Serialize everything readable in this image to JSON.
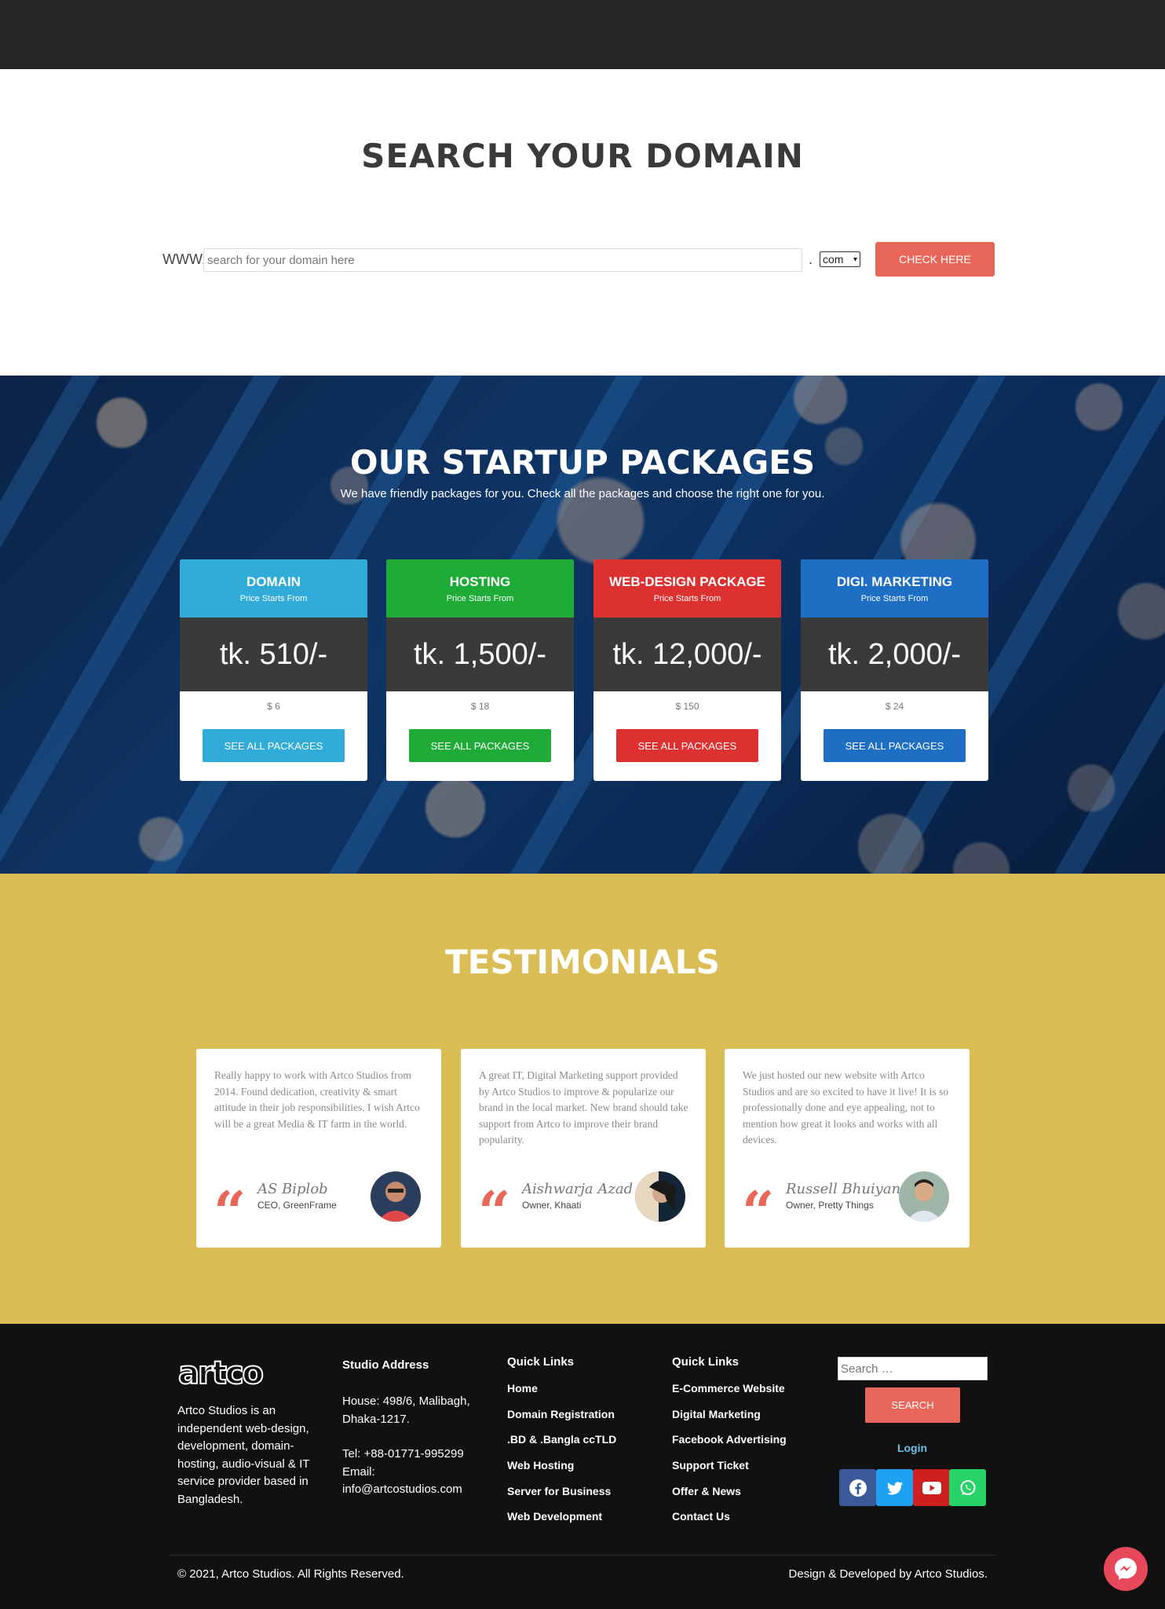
{
  "domain_search": {
    "title": "SEARCH YOUR DOMAIN",
    "prefix": "WWW.",
    "placeholder": "search for your domain here",
    "dot": ".",
    "tld_selected": "com",
    "button": "CHECK HERE"
  },
  "packages": {
    "title": "OUR STARTUP PACKAGES",
    "subtitle": "We have friendly packages for you. Check all the packages and choose the right one for you.",
    "items": [
      {
        "name": "DOMAIN",
        "caption": "Price Starts From",
        "price": "tk. 510/-",
        "usd": "$ 6",
        "button": "SEE ALL PACKAGES",
        "color": "#31acd8"
      },
      {
        "name": "HOSTING",
        "caption": "Price Starts From",
        "price": "tk. 1,500/-",
        "usd": "$ 18",
        "button": "SEE ALL PACKAGES",
        "color": "#1fab37"
      },
      {
        "name": "WEB-DESIGN PACKAGE",
        "caption": "Price Starts From",
        "price": "tk. 12,000/-",
        "usd": "$ 150",
        "button": "SEE ALL PACKAGES",
        "color": "#dd3131"
      },
      {
        "name": "DIGI. MARKETING",
        "caption": "Price Starts From",
        "price": "tk. 2,000/-",
        "usd": "$ 24",
        "button": "SEE ALL PACKAGES",
        "color": "#1e6fc4"
      }
    ]
  },
  "testimonials": {
    "title": "TESTIMONIALS",
    "items": [
      {
        "text": "Really happy to work with Artco Studios from 2014. Found dedication, creativity & smart attitude in their job responsibilities. I wish Artco will be a great Media & IT farm in the world.",
        "name": "AS Biplob",
        "role": "CEO, GreenFrame"
      },
      {
        "text": "A great IT, Digital Marketing support provided by Artco Studios to improve & popularize our brand in the local market. New brand should take support from Artco to improve their brand popularity.",
        "name": "Aishwarja Azad",
        "role": "Owner, Khaati"
      },
      {
        "text": "We just hosted our new website with Artco Studios and are so excited to have it live! It is so professionally done and eye appealing, not to mention how great it looks and works with all devices.",
        "name": "Russell Bhuiyan",
        "role": "Owner, Pretty Things"
      }
    ]
  },
  "footer": {
    "logo": "artco",
    "about": "Artco Studios is an independent web-design, development, domain-hosting, audio-visual & IT service provider based in Bangladesh.",
    "address_title": "Studio Address",
    "address": "House: 498/6, Malibagh, Dhaka-1217.",
    "tel": "Tel: +88-01771-995299",
    "email_label": "Email:",
    "email": "info@artcostudios.com",
    "links1_title": "Quick Links",
    "links1": [
      "Home",
      "Domain Registration",
      ".BD & .Bangla ccTLD",
      "Web Hosting",
      "Server for Business",
      "Web Development"
    ],
    "links2_title": "Quick Links",
    "links2": [
      "E-Commerce Website",
      "Digital Marketing",
      "Facebook Advertising",
      "Support Ticket",
      "Offer & News",
      "Contact Us"
    ],
    "search_placeholder": "Search …",
    "search_button": "SEARCH",
    "login": "Login",
    "social": [
      {
        "icon": "facebook-icon",
        "color": "#3b5998"
      },
      {
        "icon": "twitter-icon",
        "color": "#1da1f2"
      },
      {
        "icon": "youtube-icon",
        "color": "#cd201f"
      },
      {
        "icon": "whatsapp-icon",
        "color": "#25d366"
      }
    ],
    "copyright": "© 2021, Artco Studios. All Rights Reserved.",
    "credit": "Design & Developed by Artco Studios."
  }
}
